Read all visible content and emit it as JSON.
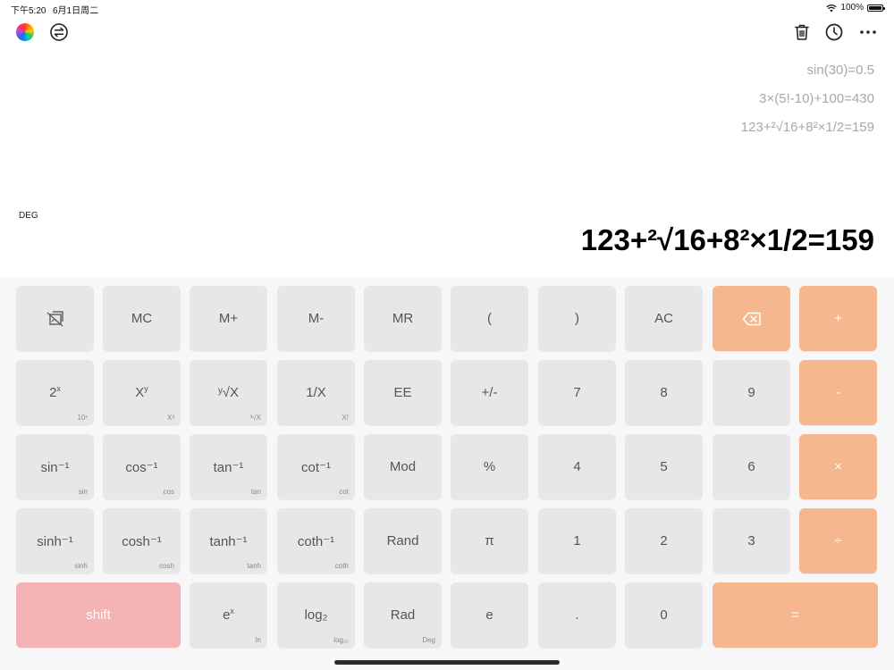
{
  "status_bar": {
    "time": "下午5:20",
    "date": "6月1日周二",
    "battery": "100%"
  },
  "history": [
    "sin(30)=0.5",
    "3×(5!-10)+100=430",
    "123+²√16+8²×1/2=159"
  ],
  "mode": "DEG",
  "result": "123+²√16+8²×1/2=159",
  "keys": {
    "mc": "MC",
    "m_plus": "M+",
    "m_minus": "M-",
    "mr": "MR",
    "open_paren": "(",
    "close_paren": ")",
    "ac": "AC",
    "plus": "+",
    "two_pow_x": "2",
    "two_pow_x_sup": "x",
    "two_pow_x_sub": "10ˣ",
    "x_pow_y": "X",
    "x_pow_y_sup": "y",
    "x_pow_y_sub": "X³",
    "y_root_x": "ʸ√X",
    "y_root_x_sub": "³√X",
    "reciprocal": "1/X",
    "reciprocal_sub": "X!",
    "ee": "EE",
    "plus_minus": "+/-",
    "d7": "7",
    "d8": "8",
    "d9": "9",
    "minus": "-",
    "asin": "sin⁻¹",
    "asin_sub": "sin",
    "acos": "cos⁻¹",
    "acos_sub": "cos",
    "atan": "tan⁻¹",
    "atan_sub": "tan",
    "acot": "cot⁻¹",
    "acot_sub": "cot",
    "mod": "Mod",
    "percent": "%",
    "d4": "4",
    "d5": "5",
    "d6": "6",
    "multiply": "×",
    "asinh": "sinh⁻¹",
    "asinh_sub": "sinh",
    "acosh": "cosh⁻¹",
    "acosh_sub": "cosh",
    "atanh": "tanh⁻¹",
    "atanh_sub": "tanh",
    "acoth": "coth⁻¹",
    "acoth_sub": "coth",
    "rand": "Rand",
    "pi": "π",
    "d1": "1",
    "d2": "2",
    "d3": "3",
    "divide": "÷",
    "shift": "shift",
    "exp": "e",
    "exp_sup": "x",
    "exp_sub": "ln",
    "log2": "log₂",
    "log2_sub": "log₁₀",
    "rad": "Rad",
    "rad_sub": "Deg",
    "e": "e",
    "dot": ".",
    "d0": "0",
    "equals": "="
  },
  "colors": {
    "operator": "#f6b68e",
    "shift": "#f3b2b4",
    "key": "#e7e7e9",
    "history_text": "#a8a8a8"
  }
}
